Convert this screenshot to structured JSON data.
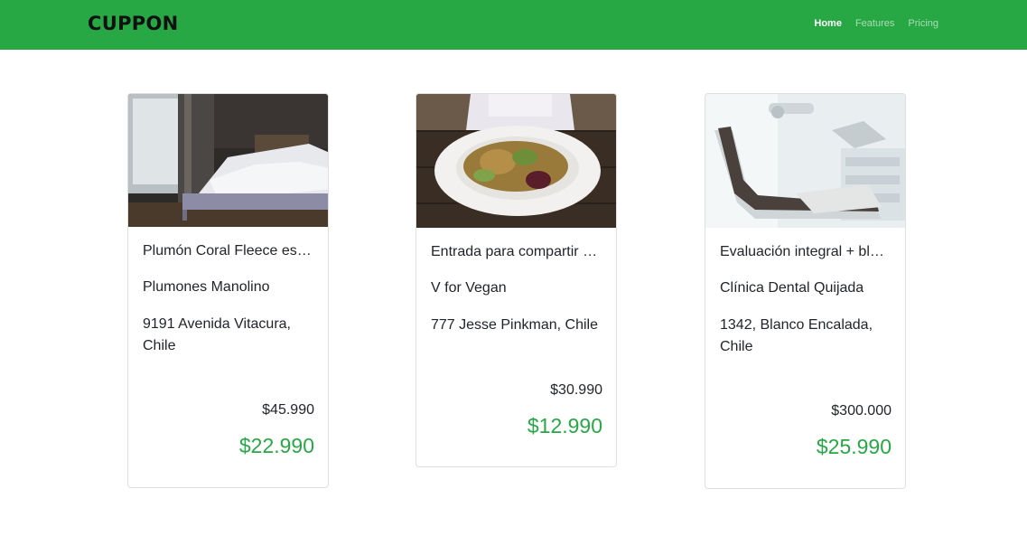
{
  "navbar": {
    "brand": "CUPPON",
    "links": [
      {
        "label": "Home",
        "active": true
      },
      {
        "label": "Features",
        "active": false
      },
      {
        "label": "Pricing",
        "active": false
      }
    ],
    "color": "#28a745"
  },
  "cards": [
    {
      "image": "bedroom-photo",
      "title": "Plumón Coral Fleece est…",
      "merchant": "Plumones Manolino",
      "address": "9191 Avenida Vitacura, Chile",
      "old_price": "$45.990",
      "new_price": "$22.990"
    },
    {
      "image": "salad-plate-photo",
      "title": "Entrada para compartir +…",
      "merchant": "V for Vegan",
      "address": "777 Jesse Pinkman, Chile",
      "old_price": "$30.990",
      "new_price": "$12.990"
    },
    {
      "image": "dental-chair-photo",
      "title": "Evaluación integral + bla…",
      "merchant": "Clínica Dental Quijada",
      "address": "1342, Blanco Encalada, Chile",
      "old_price": "$300.000",
      "new_price": "$25.990"
    }
  ],
  "accent_color": "#28a745"
}
